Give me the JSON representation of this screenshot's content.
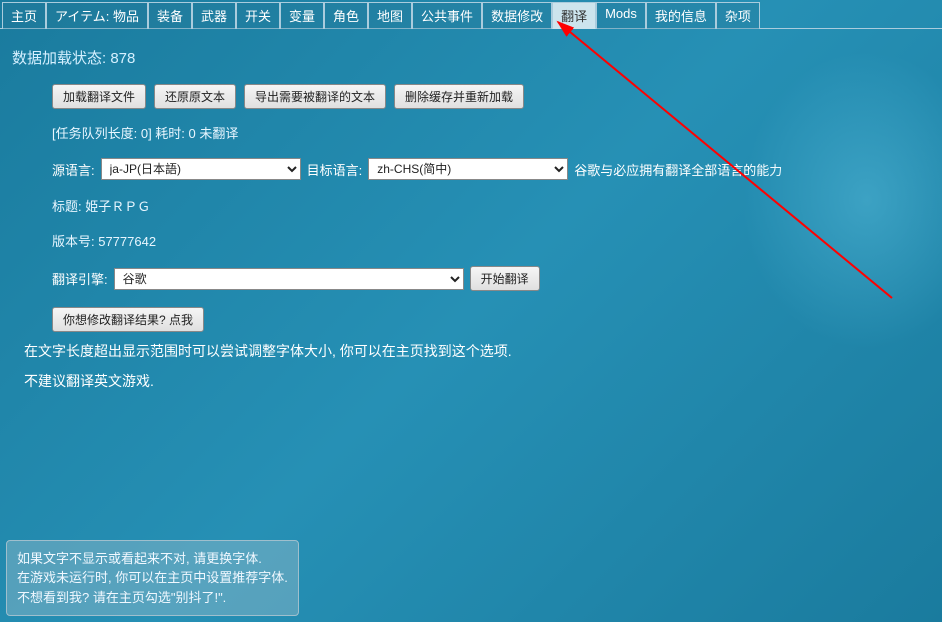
{
  "tabs": [
    {
      "label": "主页"
    },
    {
      "label": "アイテム: 物品"
    },
    {
      "label": "装备"
    },
    {
      "label": "武器"
    },
    {
      "label": "开关"
    },
    {
      "label": "变量"
    },
    {
      "label": "角色"
    },
    {
      "label": "地图"
    },
    {
      "label": "公共事件"
    },
    {
      "label": "数据修改"
    },
    {
      "label": "翻译",
      "active": true
    },
    {
      "label": "Mods"
    },
    {
      "label": "我的信息"
    },
    {
      "label": "杂项"
    }
  ],
  "status": {
    "label": "数据加载状态: 878"
  },
  "buttons": {
    "load_file": "加载翻译文件",
    "revert": "还原原文本",
    "export": "导出需要被翻译的文本",
    "clear_cache": "删除缓存并重新加载",
    "start": "开始翻译",
    "modify": "你想修改翻译结果? 点我"
  },
  "queue_line": "[任务队列长度: 0] 耗时: 0 未翻译",
  "source_lang": {
    "label": "源语言:",
    "value": "ja-JP(日本語)"
  },
  "target_lang": {
    "label": "目标语言:",
    "value": "zh-CHS(简中)"
  },
  "capability_note": "谷歌与必应拥有翻译全部语言的能力",
  "title_line": "标题: 姫子ＲＰＧ",
  "version_line": "版本号: 57777642",
  "engine": {
    "label": "翻译引擎:",
    "value": "谷歌"
  },
  "note1": "在文字长度超出显示范围时可以尝试调整字体大小, 你可以在主页找到这个选项.",
  "note2": "不建议翻译英文游戏.",
  "hint": {
    "l1": "如果文字不显示或看起来不对, 请更换字体.",
    "l2": "在游戏未运行时, 你可以在主页中设置推荐字体.",
    "l3": "不想看到我? 请在主页勾选\"别抖了!\"."
  }
}
